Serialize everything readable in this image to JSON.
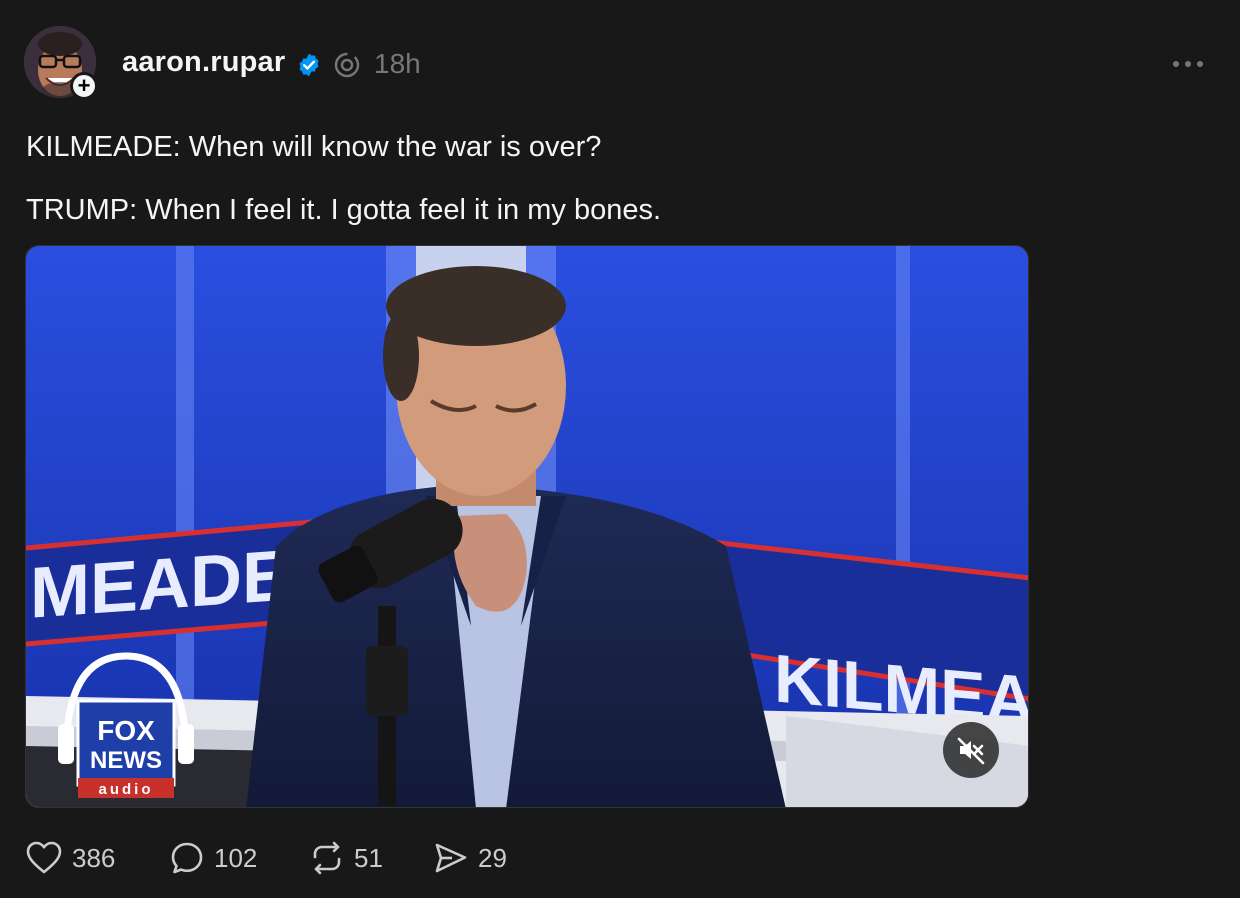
{
  "post": {
    "author": {
      "username": "aaron.rupar",
      "verified": true,
      "follow_icon": "plus-icon"
    },
    "time": "18h",
    "text_lines": [
      "KILMEADE: When will know the war is over?",
      "TRUMP: When I feel it. I gotta feel it in my bones."
    ],
    "video": {
      "muted": true,
      "backdrop_left_text": "MEADE SH",
      "backdrop_right_text": "N KILMEADE S",
      "logo_line1": "FOX",
      "logo_line2": "NEWS",
      "logo_line3": "audio"
    },
    "actions": {
      "likes": "386",
      "replies": "102",
      "reposts": "51",
      "shares": "29"
    }
  },
  "colors": {
    "background": "#181818",
    "text": "#f3f5f7",
    "muted_text": "#777777",
    "verified_blue": "#0095f6",
    "studio_blue": "#1a3fc8"
  }
}
